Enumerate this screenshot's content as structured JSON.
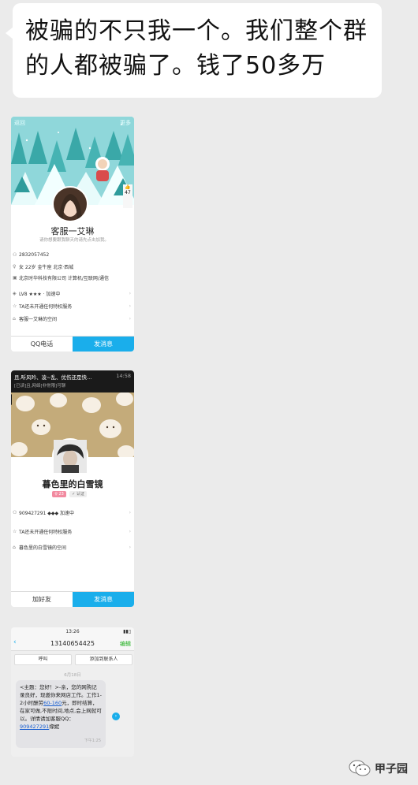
{
  "chat": {
    "message": "被骗的不只我一个。我们整个群的人都被骗了。钱了50多万"
  },
  "card1": {
    "top_left": "返回",
    "top_right": "更多",
    "name": "客服一艾琳",
    "signature": "请你想要跟我聊天的请先点击加我。",
    "like_count": "47",
    "rows": [
      {
        "icon": "user-icon",
        "text": "2832057452"
      },
      {
        "icon": "person-icon",
        "text": "女 22岁 金牛座 北京·西城"
      },
      {
        "icon": "briefcase-icon",
        "text": "北京时华科技有限公司 计算机/互联网/通信"
      },
      {
        "icon": "level-icon",
        "text": "LV8 ★★★ · 加速中"
      },
      {
        "icon": "star-icon",
        "text": "TA还未开通任何特权服务"
      },
      {
        "icon": "home-icon",
        "text": "客服一艾琳的空间"
      }
    ],
    "left_button": "QQ电话",
    "right_button": "发消息"
  },
  "card2": {
    "notif_line1": "且,听风吟、凌~乱、优伤还是快…",
    "notif_time": "14:58",
    "notif_line2": "[已读]且,网络[非常限]可聊",
    "name": "暮色里的白雪镜",
    "tag1": "♀ 23",
    "tag2": "✓ 认证",
    "rows": [
      {
        "icon": "user-icon",
        "text": "909427291 ◆◆◆ 加速中"
      },
      {
        "icon": "star-icon",
        "text": "TA还未开通任何特权服务"
      },
      {
        "icon": "home-icon",
        "text": "暮色里的白雪镜的空间"
      }
    ],
    "left_button": "加好友",
    "right_button": "发消息"
  },
  "card3": {
    "status_time": "13:26",
    "phone": "13140654425",
    "edit": "编辑",
    "tab1": "呼叫",
    "tab2": "添加到联系人",
    "date": "6月18日",
    "sms_pre": "<主题：您好！>-亲，您的网购记录良好，现邀你来网店工作。工作1-2小时酬劳",
    "sms_link": "60-160",
    "sms_mid": "元，即时结算，在家可做,不限时间,地点,会上网就可以。详情请加客服QQ：",
    "sms_qq": "909427291",
    "sms_end": "缘妮",
    "sms_time": "下午1:25"
  },
  "watermark": {
    "text": "甲子园"
  }
}
